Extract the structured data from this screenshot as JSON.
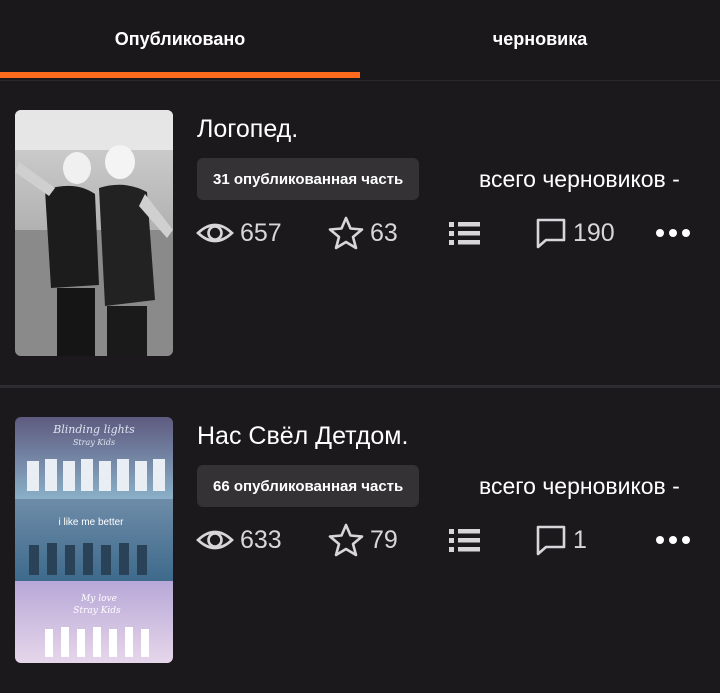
{
  "tabs": {
    "published": "Опубликовано",
    "drafts": "черновика"
  },
  "colors": {
    "accent": "#ff6a1c",
    "background": "#121013",
    "card": "#1b191c",
    "badge": "#343235"
  },
  "stories": [
    {
      "title": "Логопед.",
      "published_badge": "31 опубликованная часть",
      "drafts_text": "всего черновиков -",
      "views": "657",
      "votes": "63",
      "comments": "190",
      "cover_text": []
    },
    {
      "title": "Нас Свёл Детдом.",
      "published_badge": "66 опубликованная часть",
      "drafts_text": "всего черновиков -",
      "views": "633",
      "votes": "79",
      "comments": "1",
      "cover_text": [
        "Blinding lights",
        "Stray Kids",
        "i like me better",
        "My love",
        "Stray Kids"
      ]
    }
  ],
  "icons": [
    "eye-icon",
    "star-icon",
    "list-icon",
    "comment-icon",
    "more-icon"
  ]
}
